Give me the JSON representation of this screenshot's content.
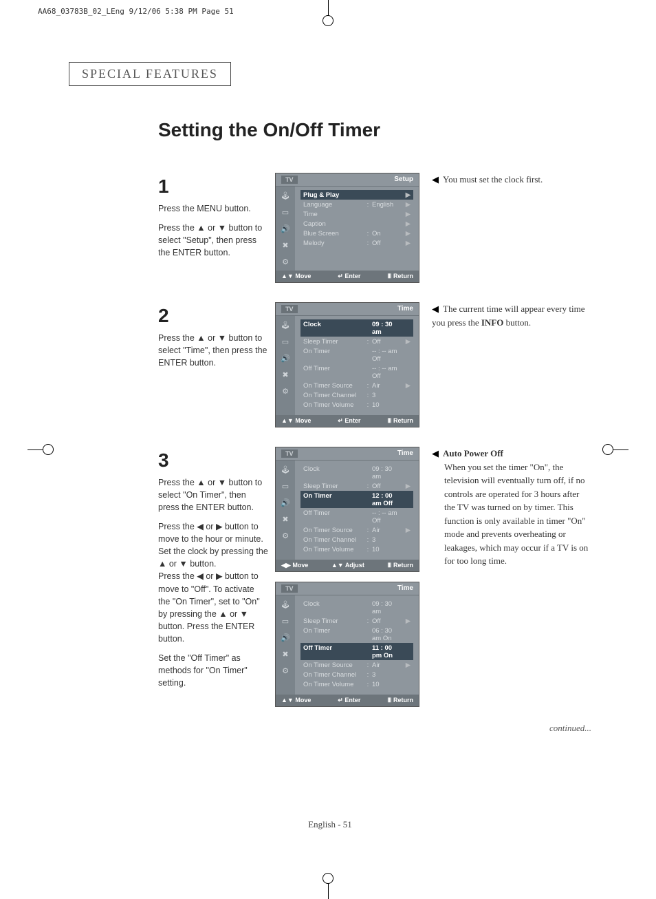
{
  "header_line": "AA68_03783B_02_LEng  9/12/06  5:38 PM  Page 51",
  "chapter": "SPECIAL FEATURES",
  "title": "Setting the On/Off Timer",
  "steps": {
    "s1": {
      "num": "1",
      "text_a": "Press the MENU button.",
      "text_b": "Press the ▲ or ▼ button to select \"Setup\", then press the ENTER button."
    },
    "s2": {
      "num": "2",
      "text_a": "Press the ▲ or ▼ button to select \"Time\", then press the ENTER button."
    },
    "s3": {
      "num": "3",
      "text_a": "Press the ▲ or ▼ button to select \"On Timer\", then press the ENTER button.",
      "text_b": "Press the ◀ or ▶ button to move to the hour or minute. Set the clock by pressing the ▲ or ▼ button.",
      "text_c": "Press the ◀ or ▶ button to move to \"Off\". To activate the \"On Timer\", set to \"On\" by pressing the ▲ or ▼ button. Press the ENTER button.",
      "text_d": "Set the \"Off Timer\" as methods for \"On Timer\" setting."
    }
  },
  "notes": {
    "n1": "You must set the clock first.",
    "n2_a": "The current time will appear every time you press the ",
    "n2_b": "INFO",
    "n2_c": " button.",
    "n3_title": "Auto Power Off",
    "n3_body": "When you set the timer \"On\", the television will eventually turn off, if no controls are operated for 3 hours after the TV was turned on by timer. This function is only available in timer \"On\" mode and prevents overheating or leakages, which may occur if a TV is on for too long time."
  },
  "menus": {
    "m1": {
      "title_right": "Setup",
      "rows": [
        {
          "lbl": "Plug & Play",
          "sep": "",
          "val": "",
          "arr": "▶",
          "sel": true
        },
        {
          "lbl": "Language",
          "sep": ":",
          "val": "English",
          "arr": "▶"
        },
        {
          "lbl": "Time",
          "sep": "",
          "val": "",
          "arr": "▶"
        },
        {
          "lbl": "Caption",
          "sep": "",
          "val": "",
          "arr": "▶"
        },
        {
          "lbl": "Blue Screen",
          "sep": ":",
          "val": "On",
          "arr": "▶"
        },
        {
          "lbl": "Melody",
          "sep": ":",
          "val": "Off",
          "arr": "▶"
        }
      ],
      "foot": {
        "a": "Move",
        "b": "Enter",
        "c": "Return"
      }
    },
    "m2": {
      "title_right": "Time",
      "rows": [
        {
          "lbl": "Clock",
          "sep": "",
          "val": "09 : 30 am",
          "arr": "",
          "sel": true
        },
        {
          "lbl": "Sleep Timer",
          "sep": ":",
          "val": "Off",
          "arr": "▶"
        },
        {
          "lbl": "On Timer",
          "sep": "",
          "val": "-- : -- am  Off",
          "arr": ""
        },
        {
          "lbl": "Off Timer",
          "sep": "",
          "val": "-- : -- am  Off",
          "arr": ""
        },
        {
          "lbl": "On Timer Source",
          "sep": ":",
          "val": "Air",
          "arr": "▶"
        },
        {
          "lbl": "On Timer Channel",
          "sep": ":",
          "val": "3",
          "arr": ""
        },
        {
          "lbl": "On Timer Volume",
          "sep": ":",
          "val": "10",
          "arr": ""
        }
      ],
      "foot": {
        "a": "Move",
        "b": "Enter",
        "c": "Return"
      }
    },
    "m3": {
      "title_right": "Time",
      "rows": [
        {
          "lbl": "Clock",
          "sep": "",
          "val": "09 : 30 am",
          "arr": ""
        },
        {
          "lbl": "Sleep Timer",
          "sep": ":",
          "val": "Off",
          "arr": "▶"
        },
        {
          "lbl": "On Timer",
          "sep": "",
          "val": "12 : 00 am  Off",
          "arr": "",
          "sel": true
        },
        {
          "lbl": "Off Timer",
          "sep": "",
          "val": "-- : -- am  Off",
          "arr": ""
        },
        {
          "lbl": "On Timer Source",
          "sep": ":",
          "val": "Air",
          "arr": "▶"
        },
        {
          "lbl": "On Timer Channel",
          "sep": ":",
          "val": "3",
          "arr": ""
        },
        {
          "lbl": "On Timer Volume",
          "sep": ":",
          "val": "10",
          "arr": ""
        }
      ],
      "foot": {
        "a": "Move",
        "b": "Adjust",
        "c": "Return"
      }
    },
    "m4": {
      "title_right": "Time",
      "rows": [
        {
          "lbl": "Clock",
          "sep": "",
          "val": "09 : 30 am",
          "arr": ""
        },
        {
          "lbl": "Sleep Timer",
          "sep": ":",
          "val": "Off",
          "arr": "▶"
        },
        {
          "lbl": "On Timer",
          "sep": "",
          "val": "06 : 30 am  On",
          "arr": ""
        },
        {
          "lbl": "Off Timer",
          "sep": "",
          "val": "11 : 00 pm  On",
          "arr": "",
          "sel": true
        },
        {
          "lbl": "On Timer Source",
          "sep": ":",
          "val": "Air",
          "arr": "▶"
        },
        {
          "lbl": "On Timer Channel",
          "sep": ":",
          "val": "3",
          "arr": ""
        },
        {
          "lbl": "On Timer Volume",
          "sep": ":",
          "val": "10",
          "arr": ""
        }
      ],
      "foot": {
        "a": "Move",
        "b": "Enter",
        "c": "Return"
      }
    }
  },
  "foot_icons": {
    "a": "▲▼",
    "b": "↵",
    "c": "Ⅲ",
    "lr": "◀▶"
  },
  "tv_tag": "TV",
  "continued": "continued...",
  "page_no": "English - 51"
}
